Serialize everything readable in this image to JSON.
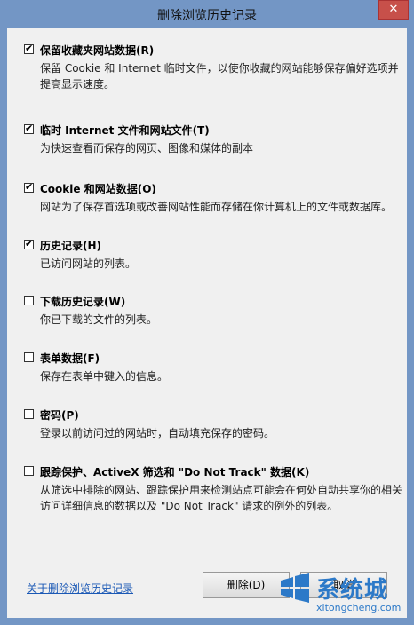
{
  "window": {
    "title": "删除浏览历史记录",
    "close_glyph": "✕"
  },
  "items": [
    {
      "label": "保留收藏夹网站数据(R)",
      "checked": true,
      "description": "保留 Cookie 和 Internet 临时文件，以使你收藏的网站能够保存偏好选项并提高显示速度。"
    },
    {
      "label": "临时 Internet 文件和网站文件(T)",
      "checked": true,
      "description": "为快速查看而保存的网页、图像和媒体的副本"
    },
    {
      "label": "Cookie 和网站数据(O)",
      "checked": true,
      "description": "网站为了保存首选项或改善网站性能而存储在你计算机上的文件或数据库。"
    },
    {
      "label": "历史记录(H)",
      "checked": true,
      "description": "已访问网站的列表。"
    },
    {
      "label": "下载历史记录(W)",
      "checked": false,
      "description": "你已下载的文件的列表。"
    },
    {
      "label": "表单数据(F)",
      "checked": false,
      "description": "保存在表单中键入的信息。"
    },
    {
      "label": "密码(P)",
      "checked": false,
      "description": "登录以前访问过的网站时，自动填充保存的密码。"
    },
    {
      "label": "跟踪保护、ActiveX 筛选和 \"Do Not Track\" 数据(K)",
      "checked": false,
      "description": "从筛选中排除的网站、跟踪保护用来检测站点可能会在何处自动共享你的相关访问详细信息的数据以及 \"Do Not Track\" 请求的例外的列表。"
    }
  ],
  "footer": {
    "about_link": "关于删除浏览历史记录",
    "delete_label": "删除(D)",
    "cancel_label": "取消"
  },
  "watermark": {
    "text": "系统城",
    "url": "xitongcheng.com"
  }
}
